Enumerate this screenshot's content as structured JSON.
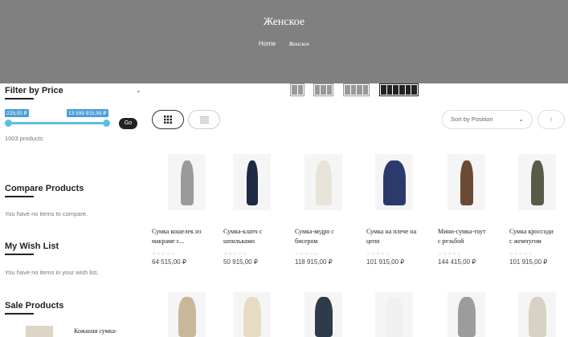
{
  "hero": {
    "title": "Женское",
    "breadcrumb_home": "Home",
    "breadcrumb_current": "Женское"
  },
  "sidebar": {
    "filter_title": "Filter by Price",
    "price_min": "229,00 ₽",
    "price_max": "13 599 915,99 ₽",
    "price_range_fraction": [
      0.0,
      1.0
    ],
    "go_label": "Go",
    "products_count": "1003 products",
    "compare_title": "Compare Products",
    "compare_empty": "You have no items to compare.",
    "wishlist_title": "My Wish List",
    "wishlist_empty": "You have no items in your wish list.",
    "sale_title": "Sale Products",
    "sale_item_name": "Кожаная сумка-"
  },
  "toolbar": {
    "column_options": [
      "2",
      "3",
      "4",
      "6"
    ],
    "active_columns": "6",
    "view_modes": [
      "grid",
      "list"
    ],
    "active_view": "grid",
    "sort_label": "Sort by Position",
    "sort_direction_icon": "arrow-up-icon"
  },
  "products": [
    {
      "name_line1": "Сумка кошелек из",
      "name_line2": "макраме с...",
      "price": "64 515,00 ₽",
      "rating_stars": 0
    },
    {
      "name_line1": "Сумка-клатч с",
      "name_line2": "шпильками",
      "price": "50 915,00 ₽",
      "rating_stars": 0
    },
    {
      "name_line1": "Сумка-ведро с",
      "name_line2": "бисером",
      "price": "118 915,00 ₽",
      "rating_stars": 0
    },
    {
      "name_line1": "Сумка на плече на",
      "name_line2": "цепи",
      "price": "101 915,00 ₽",
      "rating_stars": 0
    },
    {
      "name_line1": "Мини-сумка-тоут",
      "name_line2": "с резьбой",
      "price": "144 415,00 ₽",
      "rating_stars": 0
    },
    {
      "name_line1": "Сумка кроссоди",
      "name_line2": "с жемчугом",
      "price": "101 915,00 ₽",
      "rating_stars": 0
    }
  ],
  "colors": {
    "hero_bg": "#808080",
    "slider_accent": "#5bc0de",
    "price_tag_bg": "#4a9fd5"
  }
}
